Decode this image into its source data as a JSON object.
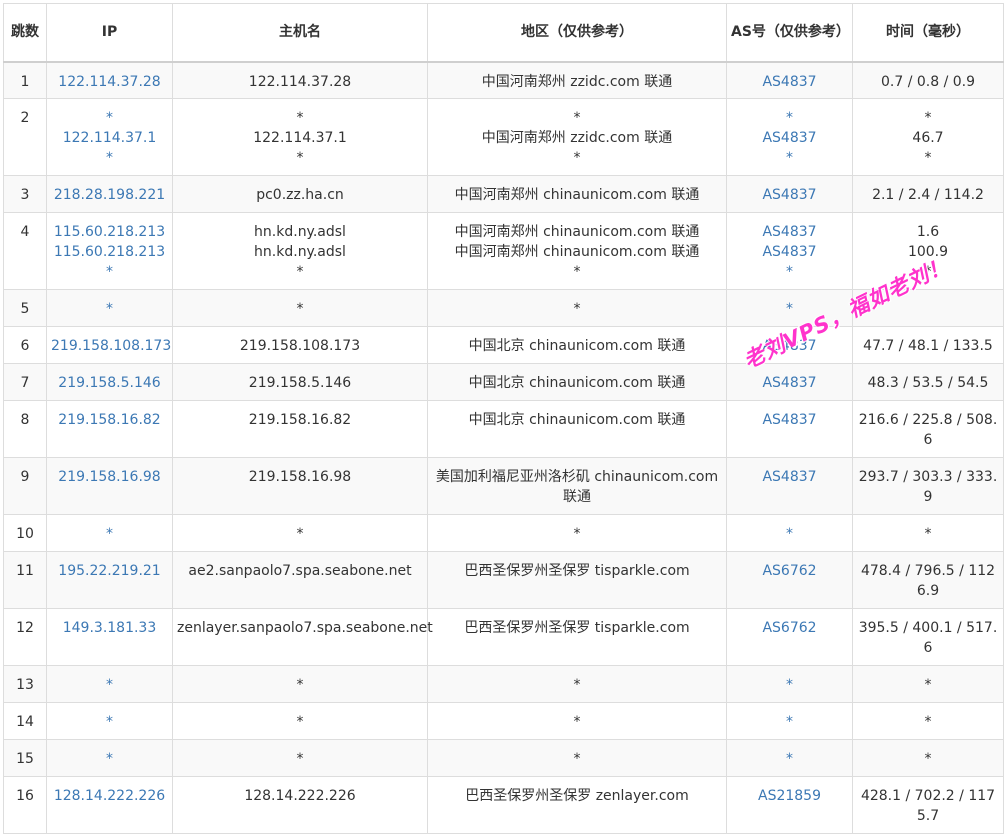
{
  "headers": [
    "跳数",
    "IP",
    "主机名",
    "地区（仅供参考）",
    "AS号（仅供参考）",
    "时间（毫秒）"
  ],
  "rows": [
    {
      "hop": "1",
      "ip": [
        "122.114.37.28"
      ],
      "host": [
        "122.114.37.28"
      ],
      "region": [
        "中国河南郑州 zzidc.com 联通"
      ],
      "as": [
        "AS4837"
      ],
      "time": [
        "0.7 / 0.8 / 0.9"
      ]
    },
    {
      "hop": "2",
      "ip": [
        "*",
        "122.114.37.1",
        "*"
      ],
      "host": [
        "*",
        "122.114.37.1",
        "*"
      ],
      "region": [
        "*",
        "中国河南郑州 zzidc.com 联通",
        "*"
      ],
      "as": [
        "*",
        "AS4837",
        "*"
      ],
      "time": [
        "*",
        "46.7",
        "*"
      ]
    },
    {
      "hop": "3",
      "ip": [
        "218.28.198.221"
      ],
      "host": [
        "pc0.zz.ha.cn"
      ],
      "region": [
        "中国河南郑州 chinaunicom.com 联通"
      ],
      "as": [
        "AS4837"
      ],
      "time": [
        "2.1 / 2.4 / 114.2"
      ]
    },
    {
      "hop": "4",
      "ip": [
        "115.60.218.213",
        "115.60.218.213",
        "*"
      ],
      "host": [
        "hn.kd.ny.adsl",
        "hn.kd.ny.adsl",
        "*"
      ],
      "region": [
        "中国河南郑州 chinaunicom.com 联通",
        "中国河南郑州 chinaunicom.com 联通",
        "*"
      ],
      "as": [
        "AS4837",
        "AS4837",
        "*"
      ],
      "time": [
        "1.6",
        "100.9",
        "*"
      ]
    },
    {
      "hop": "5",
      "ip": [
        "*"
      ],
      "host": [
        "*"
      ],
      "region": [
        "*"
      ],
      "as": [
        "*"
      ],
      "time": [
        ""
      ]
    },
    {
      "hop": "6",
      "ip": [
        "219.158.108.173"
      ],
      "host": [
        "219.158.108.173"
      ],
      "region": [
        "中国北京 chinaunicom.com 联通"
      ],
      "as": [
        "AS4837"
      ],
      "time": [
        "47.7 / 48.1 / 133.5"
      ]
    },
    {
      "hop": "7",
      "ip": [
        "219.158.5.146"
      ],
      "host": [
        "219.158.5.146"
      ],
      "region": [
        "中国北京 chinaunicom.com 联通"
      ],
      "as": [
        "AS4837"
      ],
      "time": [
        "48.3 / 53.5 / 54.5"
      ]
    },
    {
      "hop": "8",
      "ip": [
        "219.158.16.82"
      ],
      "host": [
        "219.158.16.82"
      ],
      "region": [
        "中国北京 chinaunicom.com 联通"
      ],
      "as": [
        "AS4837"
      ],
      "time": [
        "216.6 / 225.8 / 508.6"
      ]
    },
    {
      "hop": "9",
      "ip": [
        "219.158.16.98"
      ],
      "host": [
        "219.158.16.98"
      ],
      "region": [
        "美国加利福尼亚州洛杉矶 chinaunicom.com 联通"
      ],
      "as": [
        "AS4837"
      ],
      "time": [
        "293.7 / 303.3 / 333.9"
      ]
    },
    {
      "hop": "10",
      "ip": [
        "*"
      ],
      "host": [
        "*"
      ],
      "region": [
        "*"
      ],
      "as": [
        "*"
      ],
      "time": [
        "*"
      ]
    },
    {
      "hop": "11",
      "ip": [
        "195.22.219.21"
      ],
      "host": [
        "ae2.sanpaolo7.spa.seabone.net"
      ],
      "region": [
        "巴西圣保罗州圣保罗 tisparkle.com"
      ],
      "as": [
        "AS6762"
      ],
      "time": [
        "478.4 / 796.5 / 1126.9"
      ]
    },
    {
      "hop": "12",
      "ip": [
        "149.3.181.33"
      ],
      "host": [
        "zenlayer.sanpaolo7.spa.seabone.net"
      ],
      "region": [
        "巴西圣保罗州圣保罗 tisparkle.com"
      ],
      "as": [
        "AS6762"
      ],
      "time": [
        "395.5 / 400.1 / 517.6"
      ]
    },
    {
      "hop": "13",
      "ip": [
        "*"
      ],
      "host": [
        "*"
      ],
      "region": [
        "*"
      ],
      "as": [
        "*"
      ],
      "time": [
        "*"
      ]
    },
    {
      "hop": "14",
      "ip": [
        "*"
      ],
      "host": [
        "*"
      ],
      "region": [
        "*"
      ],
      "as": [
        "*"
      ],
      "time": [
        "*"
      ]
    },
    {
      "hop": "15",
      "ip": [
        "*"
      ],
      "host": [
        "*"
      ],
      "region": [
        "*"
      ],
      "as": [
        "*"
      ],
      "time": [
        "*"
      ]
    },
    {
      "hop": "16",
      "ip": [
        "128.14.222.226"
      ],
      "host": [
        "128.14.222.226"
      ],
      "region": [
        "巴西圣保罗州圣保罗 zenlayer.com"
      ],
      "as": [
        "AS21859"
      ],
      "time": [
        "428.1 / 702.2 / 1175.7"
      ]
    }
  ],
  "watermark": "老刘VPS，福如老刘！",
  "colors": {
    "link": "#3c78b4",
    "watermark": "#ff33cc",
    "border": "#dddddd",
    "stripe": "#f9f9f9"
  }
}
